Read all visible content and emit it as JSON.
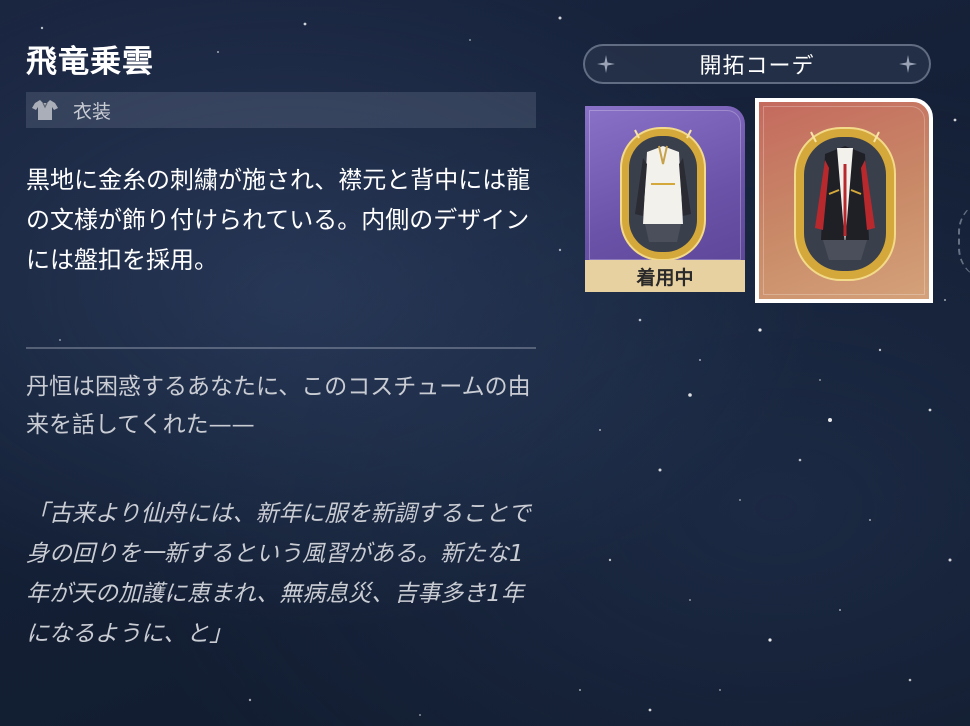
{
  "item": {
    "title": "飛竜乗雲",
    "category": "衣装",
    "category_icon": "shirt-icon",
    "description": "黒地に金糸の刺繍が施され、襟元と背中には龍の文様が飾り付けられている。内側のデザインには盤扣を採用。",
    "lore_intro": "丹恒は困惑するあなたに、このコスチュームの由来を話してくれた——",
    "lore_quote": "「古来より仙舟には、新年に服を新調することで身の回りを一新するという風習がある。新たな1年が天の加護に恵まれ、無病息災、吉事多き1年になるように、と」"
  },
  "outfit_panel": {
    "header_label": "開拓コーデ",
    "cards": [
      {
        "name": "default-outfit",
        "rarity_color": "#7a62b8",
        "badge": "着用中",
        "icon": "costume-icon",
        "selected": false
      },
      {
        "name": "dragon-outfit",
        "rarity_color": "#c98a68",
        "icon": "costume-icon",
        "selected": true
      }
    ]
  },
  "colors": {
    "background": "#142036",
    "text_primary": "#ffffff",
    "text_secondary": "#c9ccd3",
    "frame_gold": "#d4a83a",
    "badge_bg": "#e8d1a0"
  }
}
